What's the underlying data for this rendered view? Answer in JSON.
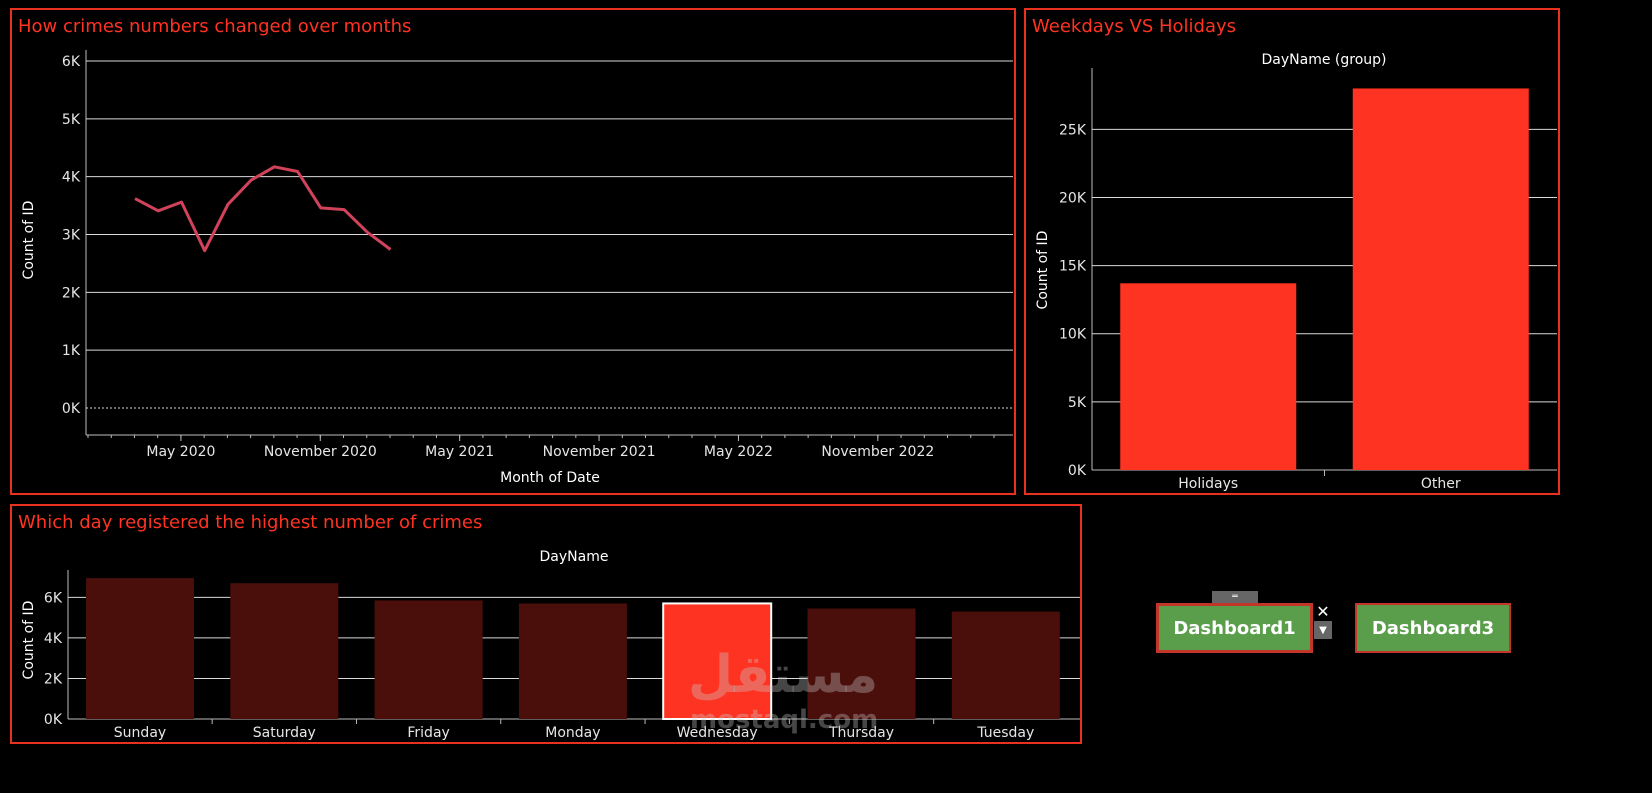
{
  "panels": {
    "line": {
      "title": "How crimes numbers changed over months"
    },
    "holiday": {
      "title": "Weekdays VS Holidays"
    },
    "days": {
      "title": "Which day registered the highest number of crimes"
    }
  },
  "buttons": {
    "dashboard1": "Dashboard1",
    "dashboard3": "Dashboard3"
  },
  "watermark": {
    "arabic": "مستقل",
    "latin": "mostaql.com"
  },
  "colors": {
    "accent": "#ff3322",
    "line": "#d1435b",
    "bar": "#ff3322",
    "bar_dim": "#4a0e0b",
    "button": "#5a9e4b"
  },
  "chart_data": [
    {
      "type": "line",
      "title": "How crimes numbers changed over months",
      "xlabel": "Month of Date",
      "ylabel": "Count of ID",
      "ylim": [
        0,
        6000
      ],
      "yticks": [
        "0K",
        "1K",
        "2K",
        "3K",
        "4K",
        "5K",
        "6K"
      ],
      "xticks": [
        "May 2020",
        "November 2020",
        "May 2021",
        "November 2021",
        "May 2022",
        "November 2022"
      ],
      "x": [
        "2020-01",
        "2020-02",
        "2020-03",
        "2020-04",
        "2020-05",
        "2020-06",
        "2020-07",
        "2020-08",
        "2020-09",
        "2020-10",
        "2020-11",
        "2020-12"
      ],
      "series": [
        {
          "values": [
            3620,
            3410,
            3560,
            2720,
            3520,
            3940,
            4170,
            4090,
            3460,
            3430,
            3040,
            2740
          ]
        }
      ]
    },
    {
      "type": "bar",
      "title": "DayName (group)",
      "ylabel": "Count of ID",
      "categories": [
        "Holidays",
        "Other"
      ],
      "values": [
        13700,
        28000
      ],
      "ylim": [
        0,
        29500
      ],
      "yticks": [
        "0K",
        "5K",
        "10K",
        "15K",
        "20K",
        "25K"
      ]
    },
    {
      "type": "bar",
      "title": "DayName",
      "ylabel": "Count of ID",
      "categories": [
        "Sunday",
        "Saturday",
        "Friday",
        "Monday",
        "Wednesday",
        "Thursday",
        "Tuesday"
      ],
      "values": [
        6950,
        6700,
        5850,
        5700,
        5700,
        5450,
        5300
      ],
      "highlighted": "Wednesday",
      "ylim": [
        0,
        7350
      ],
      "yticks": [
        "0K",
        "2K",
        "4K",
        "6K"
      ]
    }
  ]
}
